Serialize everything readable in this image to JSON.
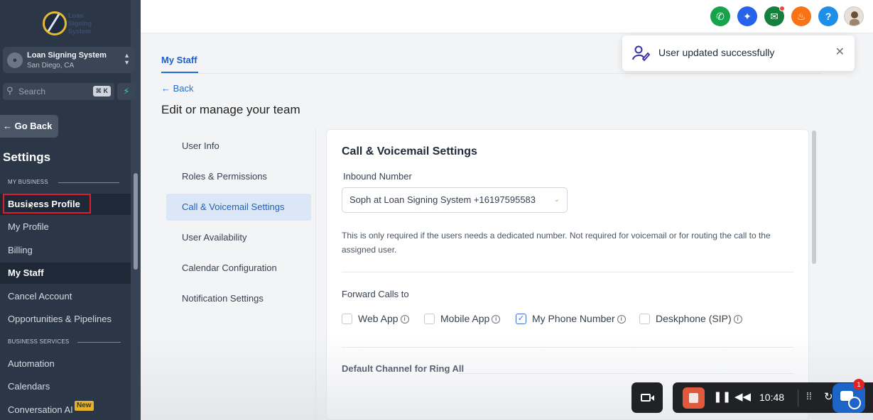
{
  "sidebar": {
    "logo_text": [
      "Loan",
      "Signing",
      "System"
    ],
    "location_name": "Loan Signing System",
    "location_city": "San Diego, CA",
    "search_label": "Search",
    "search_shortcut": "⌘ K",
    "go_back": "Go Back",
    "settings_title": "Settings",
    "section_my_business": "MY BUSINESS",
    "section_business_services": "BUSINESS SERVICES",
    "items": [
      {
        "label": "Business Profile"
      },
      {
        "label": "My Profile"
      },
      {
        "label": "Billing"
      },
      {
        "label": "My Staff"
      },
      {
        "label": "Cancel Account"
      },
      {
        "label": "Opportunities & Pipelines"
      },
      {
        "label": "Automation"
      },
      {
        "label": "Calendars"
      },
      {
        "label": "Conversation AI"
      }
    ],
    "new_badge": "New"
  },
  "topbar": {
    "icons": [
      "phone-icon",
      "sparkle-icon",
      "megaphone-icon",
      "bell-icon",
      "help-icon",
      "user-avatar"
    ],
    "help_glyph": "?",
    "colors": {
      "phone": "#16a34a",
      "sparkle": "#2563eb",
      "megaphone": "#15803d",
      "bell": "#f97316",
      "help": "#1d8fe8"
    }
  },
  "main": {
    "tab": "My Staff",
    "back": "Back",
    "title": "Edit or manage your team",
    "subnav": [
      {
        "label": "User Info"
      },
      {
        "label": "Roles & Permissions"
      },
      {
        "label": "Call & Voicemail Settings"
      },
      {
        "label": "User Availability"
      },
      {
        "label": "Calendar Configuration"
      },
      {
        "label": "Notification Settings"
      }
    ],
    "card": {
      "title": "Call & Voicemail Settings",
      "inbound_label": "Inbound Number",
      "inbound_value": "Soph at Loan Signing System +16197595583",
      "help_text": "This is only required if the users needs a dedicated number. Not required for voicemail or for routing the call to the assigned user.",
      "forward_label": "Forward Calls to",
      "forward_options": [
        {
          "label": "Web App",
          "checked": false
        },
        {
          "label": "Mobile App",
          "checked": false
        },
        {
          "label": "My Phone Number",
          "checked": true
        },
        {
          "label": "Deskphone (SIP)",
          "checked": false
        }
      ],
      "default_channel_label": "Default Channel for Ring All"
    }
  },
  "toast": {
    "message": "User updated successfully"
  },
  "recorder": {
    "time": "10:48",
    "chat_badge": "1"
  }
}
